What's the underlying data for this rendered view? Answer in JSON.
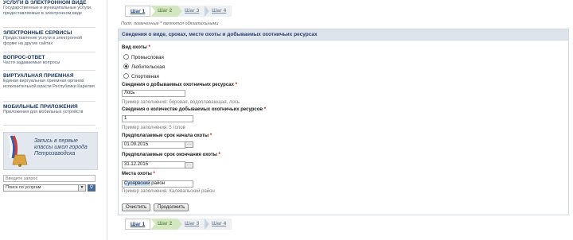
{
  "sidebar": {
    "sections": [
      {
        "title": "УСЛУГИ В ЭЛЕКТРОННОМ ВИДЕ",
        "text": "Государственные и муниципальные услуги, предоставляемые в электронном виде"
      },
      {
        "title": "ЭЛЕКТРОННЫЕ СЕРВИСЫ",
        "text": "Предоставление услуги в электронной форме на других сайтах"
      },
      {
        "title": "ВОПРОС-ОТВЕТ",
        "text": "Часто задаваемые вопросы"
      },
      {
        "title": "ВИРТУАЛЬНАЯ ПРИЕМНАЯ",
        "text": "Единая виртуальная приемная органов исполнительной власти Республики Карелия"
      },
      {
        "title": "МОБИЛЬНЫЕ ПРИЛОЖЕНИЯ",
        "text": "Приложения для мобильных устройств"
      }
    ],
    "banner_text": "Запись в первые классы школ города Петрозаводска",
    "search_placeholder": "Введите запрос",
    "search_scope": "Поиск по услугам"
  },
  "steps": [
    "Шаг 1",
    "Шаг 2",
    "Шаг 3",
    "Шаг 4"
  ],
  "required_note": {
    "before": "Поля, помеченные",
    "star": "*",
    "after": "являются обязательными"
  },
  "panel": {
    "title": "Сведения о виде, сроках, месте охоты и добываемых охотничьих ресурсах",
    "hunt_type_label": "Вид охоты",
    "hunt_types": [
      "Промысловая",
      "Любительская",
      "Спортивная"
    ],
    "selected_hunt_type": "Любительская",
    "resources_label": "Сведения о добываемых охотничьих ресурсах",
    "resources_value": "Лось",
    "resources_hint": "Пример заполнения: боровая, водоплавающая, лось",
    "quantity_label": "Сведения о количестве добываемых охотничьих ресурсов",
    "quantity_value": "1",
    "quantity_hint": "Пример заполнения: 5 голов",
    "start_label": "Предполагаемые срок начала охоты",
    "start_value": "01.09.2015",
    "end_label": "Предполагаемые срок окончания охоты",
    "end_value": "31.12.2015",
    "place_label": "Места охоты",
    "place_value_highlight": "Суоярвский",
    "place_value_rest": " район",
    "place_hint": "Пример заполнения: Калевальский район",
    "clear_button": "Очистить",
    "continue_button": "Продолжить",
    "star": "*"
  },
  "colors": {
    "accent": "#17365d",
    "active_step": "#d2e6c0",
    "required": "#cc0000"
  }
}
